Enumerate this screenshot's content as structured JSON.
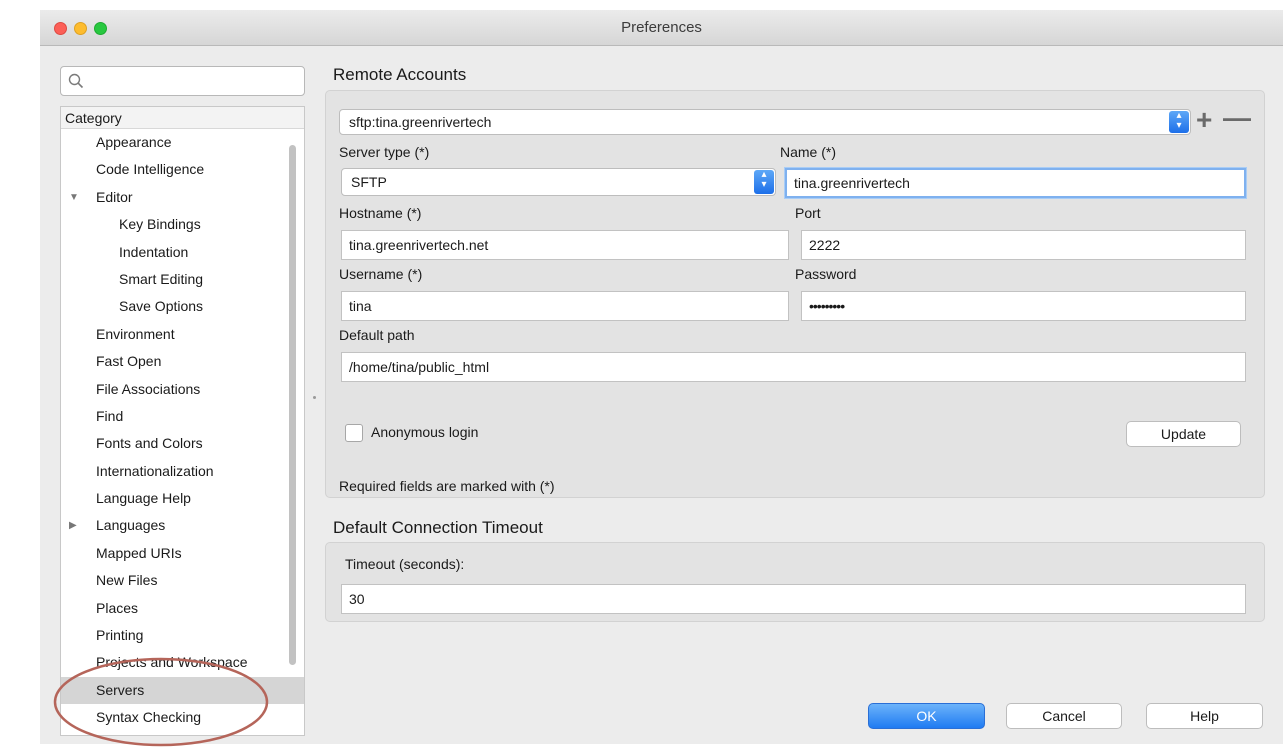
{
  "window": {
    "title": "Preferences"
  },
  "sidebar": {
    "search_placeholder": "",
    "header": "Category",
    "items": [
      {
        "label": "Appearance",
        "level": 1
      },
      {
        "label": "Code Intelligence",
        "level": 1
      },
      {
        "label": "Editor",
        "level": 1,
        "disclosure": "expanded"
      },
      {
        "label": "Key Bindings",
        "level": 2
      },
      {
        "label": "Indentation",
        "level": 2
      },
      {
        "label": "Smart Editing",
        "level": 2
      },
      {
        "label": "Save Options",
        "level": 2
      },
      {
        "label": "Environment",
        "level": 1
      },
      {
        "label": "Fast Open",
        "level": 1
      },
      {
        "label": "File Associations",
        "level": 1
      },
      {
        "label": "Find",
        "level": 1
      },
      {
        "label": "Fonts and Colors",
        "level": 1
      },
      {
        "label": "Internationalization",
        "level": 1
      },
      {
        "label": "Language Help",
        "level": 1
      },
      {
        "label": "Languages",
        "level": 1,
        "disclosure": "collapsed"
      },
      {
        "label": "Mapped URIs",
        "level": 1
      },
      {
        "label": "New Files",
        "level": 1
      },
      {
        "label": "Places",
        "level": 1
      },
      {
        "label": "Printing",
        "level": 1
      },
      {
        "label": "Projects and Workspace",
        "level": 1
      },
      {
        "label": "Servers",
        "level": 1,
        "selected": true
      },
      {
        "label": "Syntax Checking",
        "level": 1
      }
    ]
  },
  "remote_accounts": {
    "title": "Remote Accounts",
    "account_selected": "sftp:tina.greenrivertech",
    "server_type_label": "Server type (*)",
    "server_type_value": "SFTP",
    "name_label": "Name (*)",
    "name_value": "tina.greenrivertech",
    "hostname_label": "Hostname (*)",
    "hostname_value": "tina.greenrivertech.net",
    "port_label": "Port",
    "port_value": "2222",
    "username_label": "Username (*)",
    "username_value": "tina",
    "password_label": "Password",
    "password_value": "•••••••••",
    "default_path_label": "Default path",
    "default_path_value": "/home/tina/public_html",
    "anonymous_login_label": "Anonymous login",
    "anonymous_login_checked": false,
    "update_label": "Update",
    "required_note": "Required fields are marked with (*)"
  },
  "timeout": {
    "title": "Default Connection Timeout",
    "label": "Timeout (seconds):",
    "value": "30"
  },
  "buttons": {
    "ok": "OK",
    "cancel": "Cancel",
    "help": "Help"
  },
  "colors": {
    "accent_blue": "#1f7bf2",
    "annotation_circle": "#b5655a",
    "selection_gray": "#d5d5d5"
  }
}
